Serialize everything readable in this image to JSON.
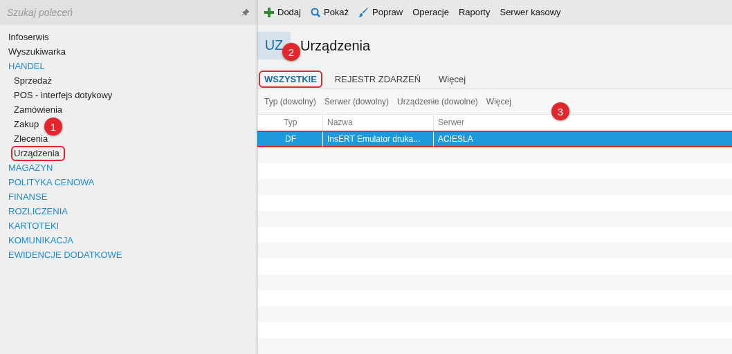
{
  "sidebar": {
    "search": {
      "placeholder": "Szukaj poleceń"
    },
    "items": [
      {
        "label": "Infoserwis",
        "kind": "link",
        "highlighted": false
      },
      {
        "label": "Wyszukiwarka",
        "kind": "link",
        "highlighted": false
      },
      {
        "label": "HANDEL",
        "kind": "section",
        "highlighted": false
      },
      {
        "label": "Sprzedaż",
        "kind": "subitem",
        "highlighted": false
      },
      {
        "label": "POS - interfejs dotykowy",
        "kind": "subitem",
        "highlighted": false
      },
      {
        "label": "Zamówienia",
        "kind": "subitem",
        "highlighted": false
      },
      {
        "label": "Zakup",
        "kind": "subitem",
        "highlighted": false
      },
      {
        "label": "Zlecenia",
        "kind": "subitem",
        "highlighted": false
      },
      {
        "label": "Urządzenia",
        "kind": "subitem",
        "highlighted": true
      },
      {
        "label": "MAGAZYN",
        "kind": "section",
        "highlighted": false
      },
      {
        "label": "POLITYKA CENOWA",
        "kind": "section",
        "highlighted": false
      },
      {
        "label": "FINANSE",
        "kind": "section",
        "highlighted": false
      },
      {
        "label": "ROZLICZENIA",
        "kind": "section",
        "highlighted": false
      },
      {
        "label": "KARTOTEKI",
        "kind": "section",
        "highlighted": false
      },
      {
        "label": "KOMUNIKACJA",
        "kind": "section",
        "highlighted": false
      },
      {
        "label": "EWIDENCJE DODATKOWE",
        "kind": "section",
        "highlighted": false
      }
    ]
  },
  "toolbar": [
    {
      "label": "Dodaj",
      "kind": "add"
    },
    {
      "label": "Pokaż",
      "kind": "search"
    },
    {
      "label": "Popraw",
      "kind": "brush"
    },
    {
      "label": "Operacje",
      "kind": "text"
    },
    {
      "label": "Raporty",
      "kind": "text"
    },
    {
      "label": "Serwer kasowy",
      "kind": "text"
    }
  ],
  "header": {
    "badge": "UZ",
    "title": "Urządzenia"
  },
  "tabs": [
    {
      "label": "WSZYSTKIE",
      "selected": true,
      "highlighted": true
    },
    {
      "label": "REJESTR ZDARZEŃ",
      "selected": false,
      "highlighted": false
    },
    {
      "label": "Więcej",
      "selected": false,
      "highlighted": false
    }
  ],
  "filters": [
    "Typ (dowolny)",
    "Serwer (dowolny)",
    "Urządzenie (dowolne)",
    "Więcej"
  ],
  "table": {
    "columns": [
      "Typ",
      "Nazwa",
      "Serwer"
    ],
    "rows": [
      {
        "cells": [
          "DF",
          "InsERT Emulator druka...",
          "ACIESLA"
        ],
        "selected": true,
        "highlighted": true
      }
    ]
  },
  "markers": [
    {
      "text": "1"
    },
    {
      "text": "2"
    },
    {
      "text": "3"
    }
  ]
}
